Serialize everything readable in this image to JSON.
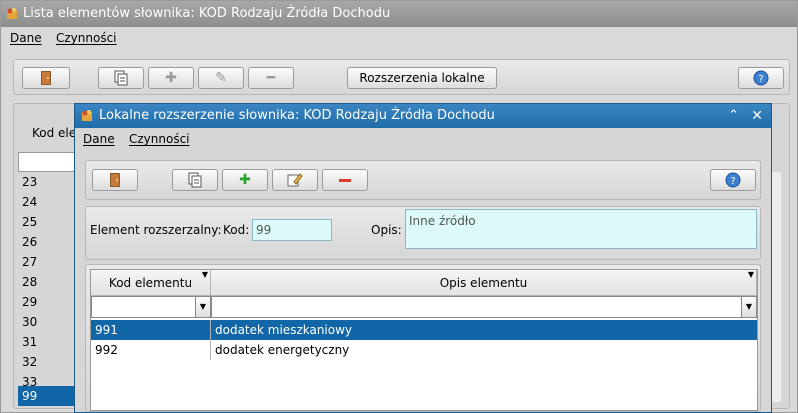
{
  "main_window": {
    "title": "Lista elementów słownika: KOD Rodzaju Źródła Dochodu",
    "menu": [
      "Dane",
      "Czynności"
    ],
    "toolbar": {
      "local_ext_label": "Rozszerzenia lokalne"
    },
    "list_header": "Kod ele",
    "rows": [
      "23",
      "24",
      "25",
      "26",
      "27",
      "28",
      "29",
      "30",
      "31",
      "32",
      "33",
      "99"
    ],
    "selected_row": "99"
  },
  "dialog": {
    "title": "Lokalne rozszerzenie słownika: KOD Rodzaju Źródła Dochodu",
    "menu": [
      "Dane",
      "Czynności"
    ],
    "form": {
      "element_label": "Element rozszerzalny:",
      "kod_label": "Kod:",
      "kod_value": "99",
      "opis_label": "Opis:",
      "opis_value": "Inne źródło"
    },
    "grid": {
      "columns": [
        "Kod elementu",
        "Opis elementu"
      ],
      "rows": [
        {
          "kod": "991",
          "opis": "dodatek mieszkaniowy",
          "selected": true
        },
        {
          "kod": "992",
          "opis": "dodatek energetyczny",
          "selected": false
        }
      ]
    }
  },
  "icons": {
    "exit": "door-icon",
    "copy": "copy-icon",
    "add": "plus-icon",
    "edit": "edit-icon",
    "remove": "minus-icon",
    "help": "help-icon"
  },
  "colors": {
    "title_active": "#1f6ca8",
    "selection": "#1166a8",
    "field_bg": "#dcfafa"
  }
}
